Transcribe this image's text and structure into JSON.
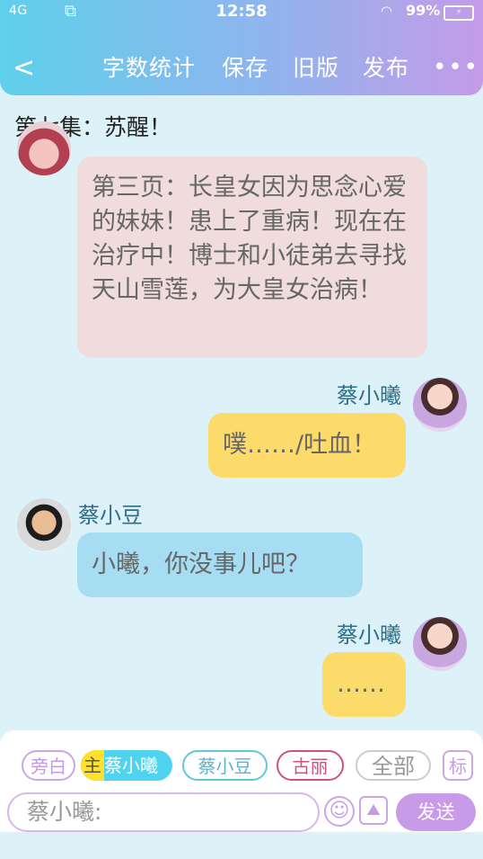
{
  "status": {
    "signal": "4G",
    "time": "12:58",
    "battery": "99%"
  },
  "nav": {
    "back": "<",
    "word_count": "字数统计",
    "save": "保存",
    "old_version": "旧版",
    "publish": "发布",
    "more": "•••"
  },
  "episode_title": "第七集：苏醒！",
  "messages": [
    {
      "text": "第三页：长皇女因为思念心爱的妹妹！患上了重病！现在在治疗中！博士和小徒弟去寻找天山雪莲，为大皇女治病！"
    },
    {
      "name": "蔡小曦",
      "text": "噗……/吐血！"
    },
    {
      "name": "蔡小豆",
      "text": "小曦，你没事儿吧？"
    },
    {
      "name": "蔡小曦",
      "text": "……"
    }
  ],
  "roles": {
    "narration": "旁白",
    "main_tag": "主",
    "main_name": "蔡小曦",
    "dou": "蔡小豆",
    "guli": "古丽",
    "all": "全部",
    "mark": "标"
  },
  "composer": {
    "placeholder": "蔡小曦:",
    "send": "发送"
  },
  "colors": {
    "accent": "#c79be8",
    "header_start": "#5fd0ec",
    "header_end": "#c49be8"
  }
}
